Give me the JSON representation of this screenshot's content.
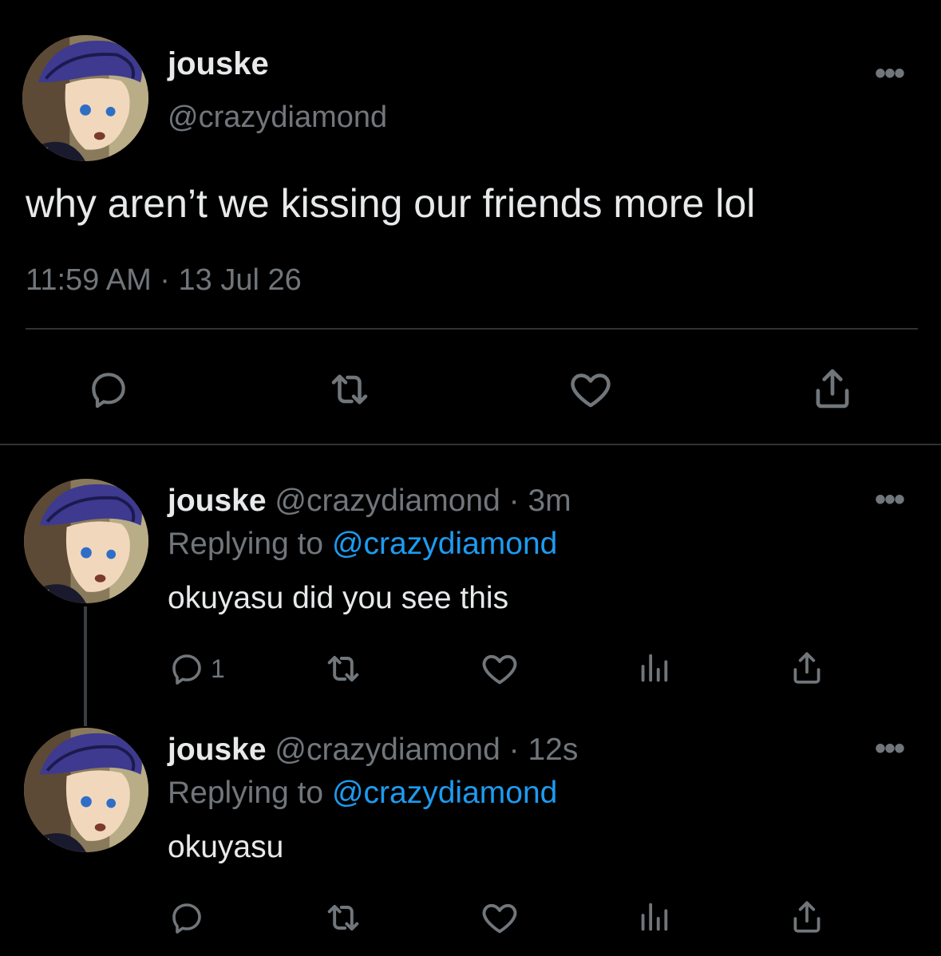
{
  "main_tweet": {
    "display_name": "jouske",
    "handle": "@crazydiamond",
    "text": "why aren’t we kissing our friends more lol",
    "timestamp": "11:59 AM · 13 Jul 26",
    "more_icon": "more-dots-icon",
    "actions": [
      "reply-icon",
      "retweet-icon",
      "like-icon",
      "share-icon"
    ]
  },
  "replies": [
    {
      "display_name": "jouske",
      "handle": "@crazydiamond",
      "time": "· 3m",
      "replying_label": "Replying to",
      "replying_handle": "@crazydiamond",
      "text": "okuyasu did you see this",
      "reply_count": "1"
    },
    {
      "display_name": "jouske",
      "handle": "@crazydiamond",
      "time": "· 12s",
      "replying_label": "Replying to",
      "replying_handle": "@crazydiamond",
      "text": "okuyasu",
      "reply_count": ""
    }
  ],
  "colors": {
    "background": "#000000",
    "text": "#e7e9ea",
    "muted": "#71767b",
    "link": "#1d9bf0",
    "divider": "#2f3336"
  }
}
